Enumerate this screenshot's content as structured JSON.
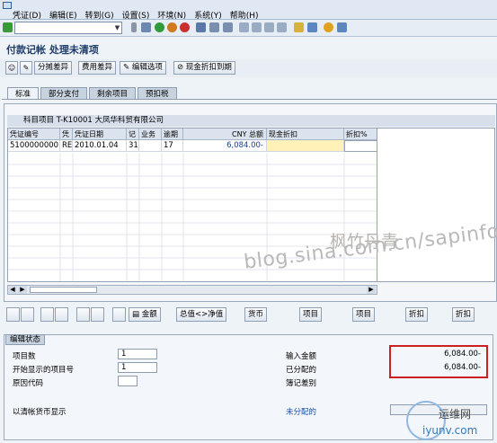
{
  "menu": [
    "凭证(D)",
    "编辑(E)",
    "转到(G)",
    "设置(S)",
    "环境(N)",
    "系统(Y)",
    "帮助(H)"
  ],
  "title": "付款记帐 处理未清项",
  "app_toolbar": {
    "distribute_diff": "分摊差异",
    "charge_diff": "费用差异",
    "edit_options": "编辑选项",
    "cash_discount_due": "现金折扣到期"
  },
  "tabs": [
    "标准",
    "部分支付",
    "剩余项目",
    "预扣税"
  ],
  "grid": {
    "title": "科目项目 T-K10001 大凤华科贸有限公司",
    "columns": [
      "凭证编号",
      "凭",
      "凭证日期",
      "记",
      "业务",
      "逾期",
      "CNY 总额",
      "现金折扣",
      "折扣%"
    ],
    "rows": [
      [
        "5100000000",
        "RE",
        "2010.01.04",
        "31",
        "",
        "17",
        "6,084.00-",
        "",
        ""
      ]
    ]
  },
  "bottom_buttons": {
    "amount": "金额",
    "gross_net": "总值<>净值",
    "currency": "货币",
    "item1": "项目",
    "item2": "项目",
    "discount1": "折扣",
    "discount2": "折扣"
  },
  "status": {
    "tab": "编辑状态",
    "item_count_label": "项目数",
    "item_count": "1",
    "first_item_label": "开始显示的项目号",
    "first_item": "1",
    "reason_code_label": "原因代码",
    "reason_code": "",
    "show_in_currency": "以清帐货币显示",
    "entered_label": "输入金额",
    "entered_value": "6,084.00-",
    "assigned_label": "已分配的",
    "assigned_value": "6,084.00-",
    "diff_label": "簿记差别",
    "diff_value": "",
    "unassigned_label": "未分配的",
    "unassigned_value": ""
  },
  "watermark": {
    "cn": "枫竹丹青",
    "url": "blog.sina.com.cn/sapinfo",
    "site_cn": "运维网",
    "site_url": "iyunv.com"
  },
  "colors": {
    "highlight_box": "#cc2020",
    "grid_yellow": "#fff1b8",
    "title_blue": "#1f3c6b"
  }
}
